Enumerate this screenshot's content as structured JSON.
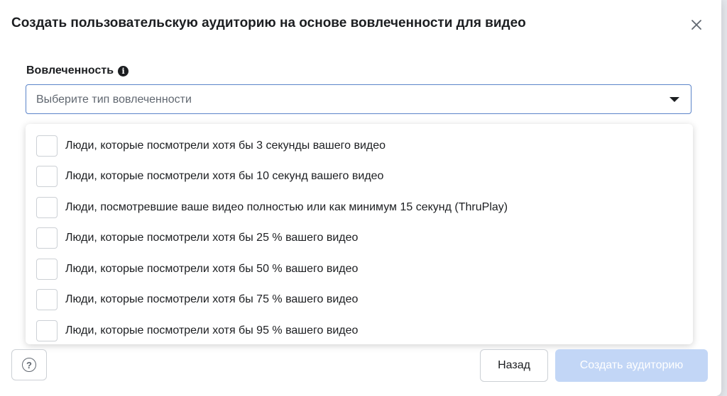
{
  "modal": {
    "title": "Создать пользовательскую аудиторию на основе вовлеченности для видео"
  },
  "engagement": {
    "label": "Вовлеченность",
    "placeholder": "Выберите тип вовлеченности",
    "options": [
      {
        "label": "Люди, которые посмотрели хотя бы 3 секунды вашего видео",
        "checked": false
      },
      {
        "label": "Люди, которые посмотрели хотя бы 10 секунд вашего видео",
        "checked": false
      },
      {
        "label": "Люди, посмотревшие ваше видео полностью или как минимум 15 секунд (ThruPlay)",
        "checked": false
      },
      {
        "label": "Люди, которые посмотрели хотя бы 25 % вашего видео",
        "checked": false
      },
      {
        "label": "Люди, которые посмотрели хотя бы 50 % вашего видео",
        "checked": false
      },
      {
        "label": "Люди, которые посмотрели хотя бы 75 % вашего видео",
        "checked": false
      },
      {
        "label": "Люди, которые посмотрели хотя бы 95 % вашего видео",
        "checked": false
      }
    ]
  },
  "footer": {
    "back_label": "Назад",
    "create_label": "Создать аудиторию"
  },
  "colors": {
    "select_border": "#5b84c9",
    "primary_disabled": "#c2d6f6"
  }
}
